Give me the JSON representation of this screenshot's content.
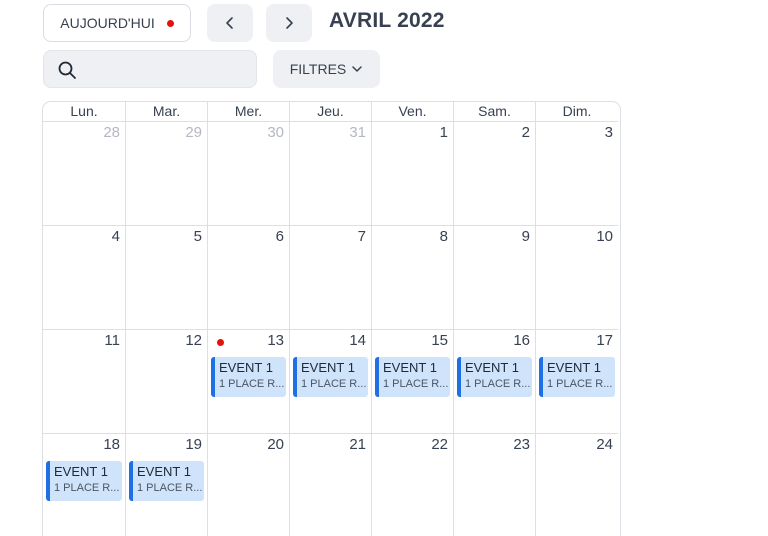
{
  "toolbar": {
    "today_label": "AUJOURD'HUI",
    "prev_icon": "chevron-left-icon",
    "next_icon": "chevron-right-icon",
    "month_title": "AVRIL 2022",
    "search_value": "",
    "search_placeholder": "",
    "filters_label": "FILTRES"
  },
  "colors": {
    "today_dot": "#e3120b",
    "event_bg": "#cfe3fb",
    "event_accent": "#1f6fe5",
    "other_month_text": "#b4b8bf"
  },
  "calendar": {
    "weekdays": [
      "Lun.",
      "Mar.",
      "Mer.",
      "Jeu.",
      "Ven.",
      "Sam.",
      "Dim."
    ],
    "weeks": [
      [
        {
          "num": "28",
          "other": true,
          "events": []
        },
        {
          "num": "29",
          "other": true,
          "events": []
        },
        {
          "num": "30",
          "other": true,
          "events": []
        },
        {
          "num": "31",
          "other": true,
          "events": []
        },
        {
          "num": "1",
          "events": []
        },
        {
          "num": "2",
          "events": []
        },
        {
          "num": "3",
          "events": []
        }
      ],
      [
        {
          "num": "4",
          "events": []
        },
        {
          "num": "5",
          "events": []
        },
        {
          "num": "6",
          "events": []
        },
        {
          "num": "7",
          "events": []
        },
        {
          "num": "8",
          "events": []
        },
        {
          "num": "9",
          "events": []
        },
        {
          "num": "10",
          "events": []
        }
      ],
      [
        {
          "num": "11",
          "events": []
        },
        {
          "num": "12",
          "events": []
        },
        {
          "num": "13",
          "today": true,
          "events": [
            {
              "title": "EVENT 1",
              "place": "1 PLACE R..."
            }
          ]
        },
        {
          "num": "14",
          "events": [
            {
              "title": "EVENT 1",
              "place": "1 PLACE R..."
            }
          ]
        },
        {
          "num": "15",
          "events": [
            {
              "title": "EVENT 1",
              "place": "1 PLACE R..."
            }
          ]
        },
        {
          "num": "16",
          "events": [
            {
              "title": "EVENT 1",
              "place": "1 PLACE R..."
            }
          ]
        },
        {
          "num": "17",
          "events": [
            {
              "title": "EVENT 1",
              "place": "1 PLACE R..."
            }
          ]
        }
      ],
      [
        {
          "num": "18",
          "events": [
            {
              "title": "EVENT 1",
              "place": "1 PLACE R..."
            }
          ]
        },
        {
          "num": "19",
          "events": [
            {
              "title": "EVENT 1",
              "place": "1 PLACE R..."
            }
          ]
        },
        {
          "num": "20",
          "events": []
        },
        {
          "num": "21",
          "events": []
        },
        {
          "num": "22",
          "events": []
        },
        {
          "num": "23",
          "events": []
        },
        {
          "num": "24",
          "events": []
        }
      ]
    ]
  }
}
